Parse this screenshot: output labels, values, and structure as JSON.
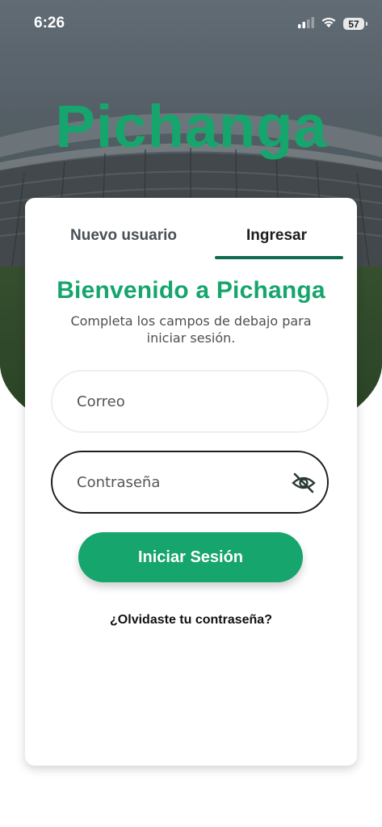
{
  "status_bar": {
    "time": "6:26",
    "battery": "57"
  },
  "brand": {
    "logo_text": "Pichanga",
    "logo_color": "#16a56c"
  },
  "tabs": {
    "new_user": "Nuevo usuario",
    "login": "Ingresar",
    "active_color": "#0f6b52"
  },
  "login": {
    "title": "Bienvenido a Pichanga",
    "subtitle": "Completa los campos de debajo para iniciar sesión.",
    "email_placeholder": "Correo",
    "password_placeholder": "Contraseña",
    "submit_label": "Iniciar Sesión",
    "forgot_label": "¿Olvidaste tu contraseña?"
  },
  "icons": {
    "password_toggle": "eye-off-icon"
  },
  "colors": {
    "primary": "#16a56c",
    "dark": "#1e1e1e"
  }
}
